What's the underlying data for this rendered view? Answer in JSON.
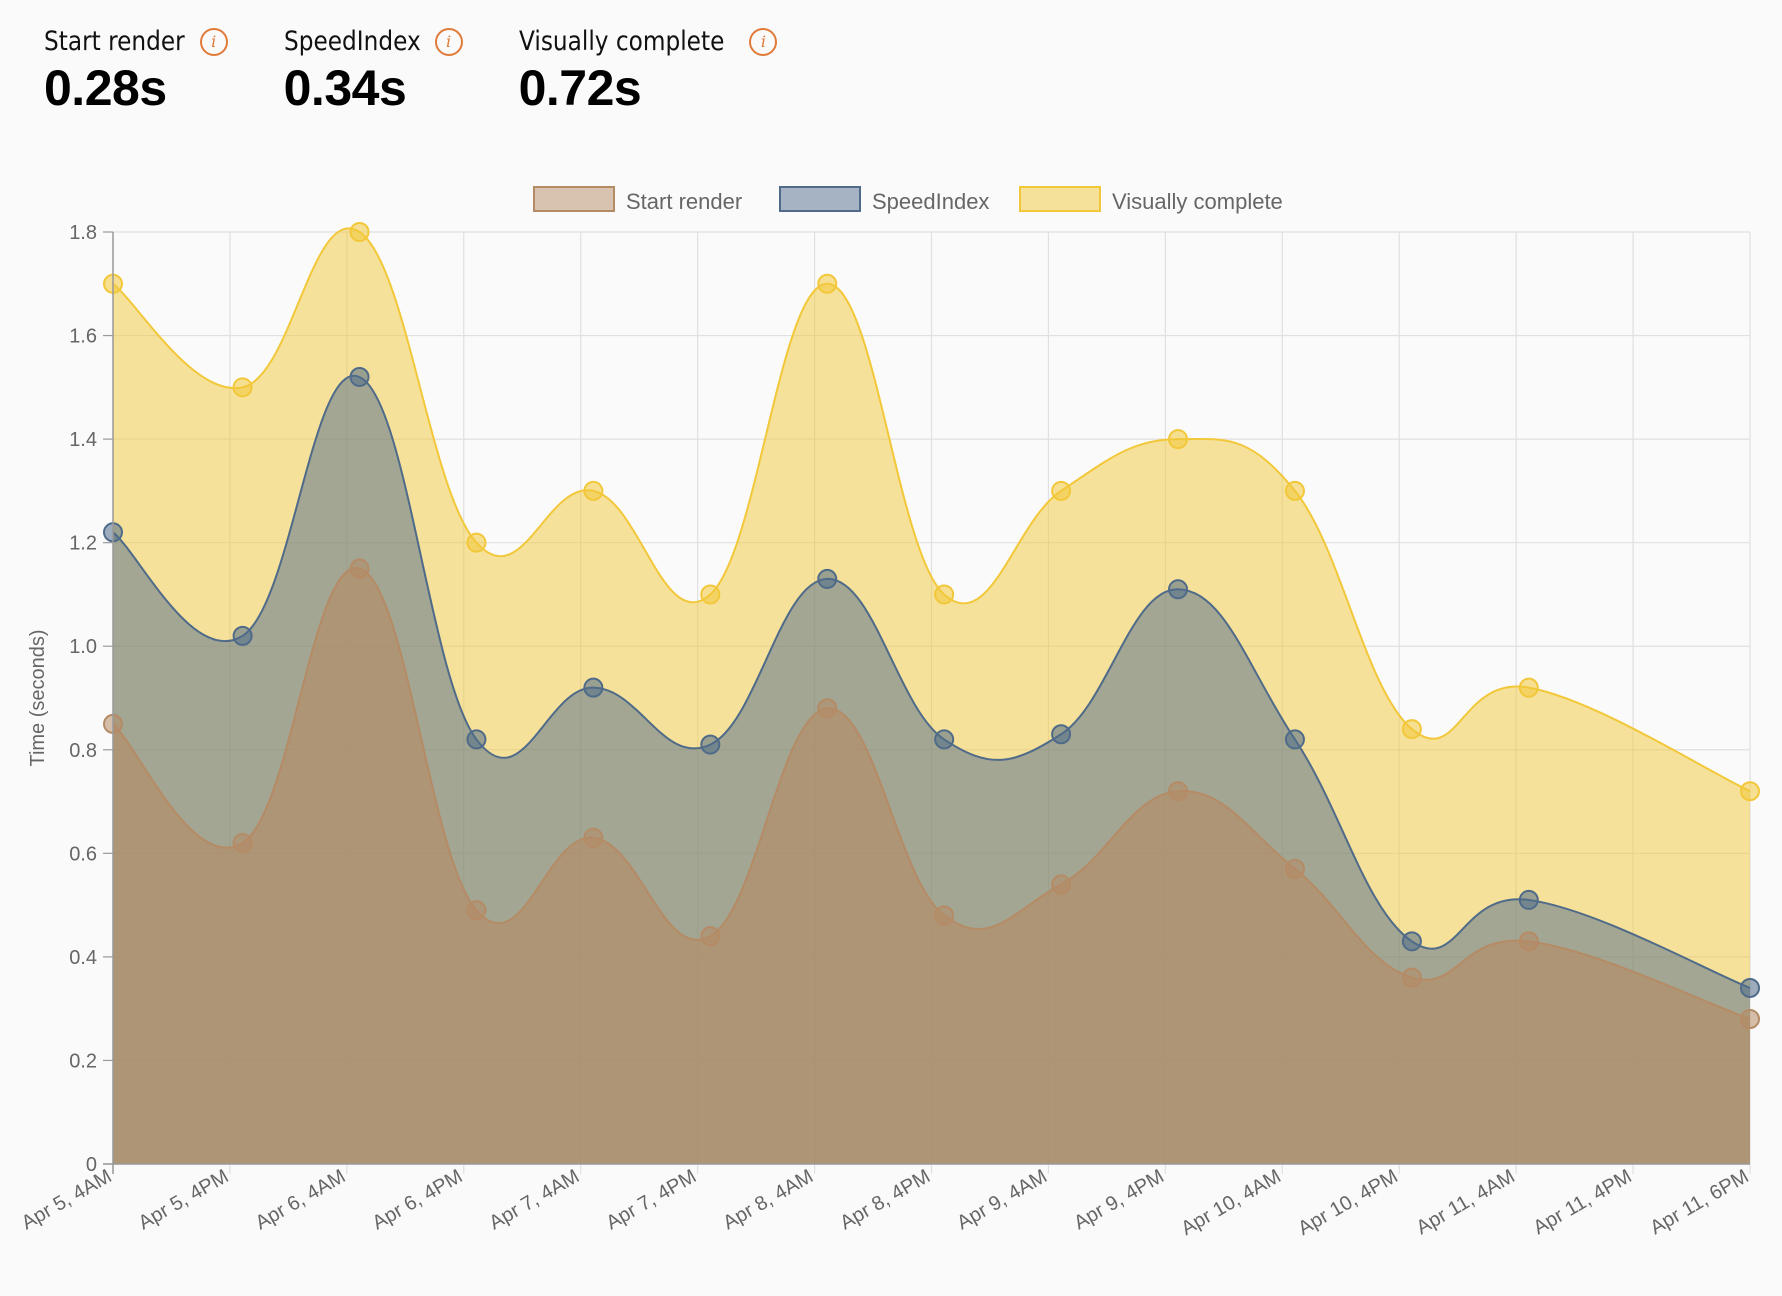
{
  "metrics": [
    {
      "label": "Start render",
      "value": "0.28s",
      "info_icon": "info-icon"
    },
    {
      "label": "SpeedIndex",
      "value": "0.34s",
      "info_icon": "info-icon"
    },
    {
      "label": "Visually complete",
      "value": "0.72s",
      "info_icon": "info-icon"
    }
  ],
  "colors": {
    "accent": "#e07b39",
    "start_render": "#b58b66",
    "speed_index": "#4f6b89",
    "visually_complete": "#f2c83a"
  },
  "chart_data": {
    "type": "area",
    "title": "",
    "xlabel": "",
    "ylabel": "Time (seconds)",
    "ylim": [
      0,
      1.8
    ],
    "yticks": [
      "0",
      "0.2",
      "0.4",
      "0.6",
      "0.8",
      "1.0",
      "1.2",
      "1.4",
      "1.6",
      "1.8"
    ],
    "xticks": [
      "Apr 5, 4AM",
      "Apr 5, 4PM",
      "Apr 6, 4AM",
      "Apr 6, 4PM",
      "Apr 7, 4AM",
      "Apr 7, 4PM",
      "Apr 8, 4AM",
      "Apr 8, 4PM",
      "Apr 9, 4AM",
      "Apr 9, 4PM",
      "Apr 10, 4AM",
      "Apr 10, 4PM",
      "Apr 11, 4AM",
      "Apr 11, 4PM",
      "Apr 11, 6PM"
    ],
    "grid": true,
    "legend": "top-center",
    "x_hours": [
      0,
      12,
      24,
      36,
      48,
      60,
      72,
      84,
      96,
      108,
      120,
      132,
      144,
      156
    ],
    "series": [
      {
        "name": "Start render",
        "color_key": "start_render",
        "values": [
          0.85,
          0.62,
          1.15,
          0.49,
          0.63,
          0.44,
          0.88,
          0.48,
          0.54,
          0.72,
          0.57,
          0.36,
          0.43,
          0.28
        ]
      },
      {
        "name": "SpeedIndex",
        "color_key": "speed_index",
        "values": [
          1.22,
          1.02,
          1.52,
          0.82,
          0.92,
          0.81,
          1.13,
          0.82,
          0.83,
          1.11,
          0.82,
          0.43,
          0.51,
          0.34
        ]
      },
      {
        "name": "Visually complete",
        "color_key": "visually_complete",
        "values": [
          1.7,
          1.5,
          1.8,
          1.2,
          1.3,
          1.1,
          1.7,
          1.1,
          1.3,
          1.4,
          1.3,
          0.84,
          0.92,
          0.72
        ]
      }
    ]
  }
}
